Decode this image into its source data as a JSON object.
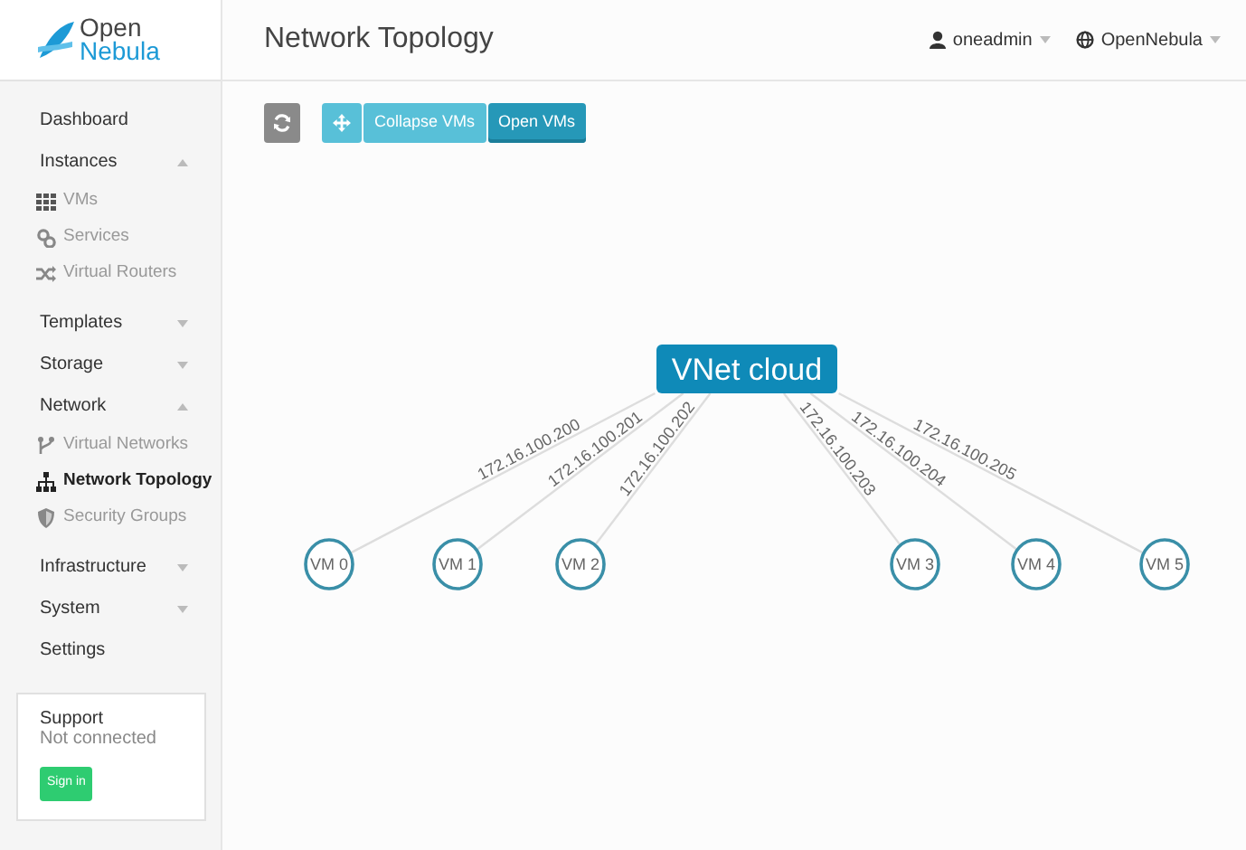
{
  "logo": {
    "line1": "Open",
    "line2": "Nebula"
  },
  "sidebar": {
    "items": [
      {
        "label": "Dashboard",
        "kind": "link"
      },
      {
        "label": "Instances",
        "kind": "group",
        "expanded": true,
        "children": [
          {
            "label": "VMs",
            "kind": "grid",
            "selected": false
          },
          {
            "label": "Services",
            "kind": "gears",
            "selected": false
          },
          {
            "label": "Virtual Routers",
            "kind": "shuffle",
            "selected": false
          }
        ]
      },
      {
        "label": "Templates",
        "kind": "group",
        "expanded": false
      },
      {
        "label": "Storage",
        "kind": "group",
        "expanded": false
      },
      {
        "label": "Network",
        "kind": "group",
        "expanded": true,
        "children": [
          {
            "label": "Virtual Networks",
            "kind": "branch",
            "selected": false
          },
          {
            "label": "Network Topology",
            "kind": "sitemap",
            "selected": true
          },
          {
            "label": "Security Groups",
            "kind": "shield",
            "selected": false
          }
        ]
      },
      {
        "label": "Infrastructure",
        "kind": "group",
        "expanded": false
      },
      {
        "label": "System",
        "kind": "group",
        "expanded": false
      },
      {
        "label": "Settings",
        "kind": "link"
      }
    ]
  },
  "support": {
    "title": "Support",
    "status": "Not connected",
    "button": "Sign in"
  },
  "header": {
    "title": "Network Topology",
    "user": "oneadmin",
    "zone": "OpenNebula"
  },
  "toolbar": {
    "buttons": [
      {
        "kind": "refresh"
      },
      {
        "kind": "move",
        "selected": false
      },
      {
        "kind": "text",
        "label": "Collapse VMs",
        "selected": false
      },
      {
        "kind": "text",
        "label": "Open VMs",
        "selected": true
      }
    ]
  },
  "topology": {
    "network": "VNet cloud",
    "vms": [
      {
        "name": "VM 0",
        "ip": "172.16.100.200"
      },
      {
        "name": "VM 1",
        "ip": "172.16.100.201"
      },
      {
        "name": "VM 2",
        "ip": "172.16.100.202"
      },
      {
        "name": "VM 3",
        "ip": "172.16.100.203"
      },
      {
        "name": "VM 4",
        "ip": "172.16.100.204"
      },
      {
        "name": "VM 5",
        "ip": "172.16.100.205"
      }
    ]
  }
}
